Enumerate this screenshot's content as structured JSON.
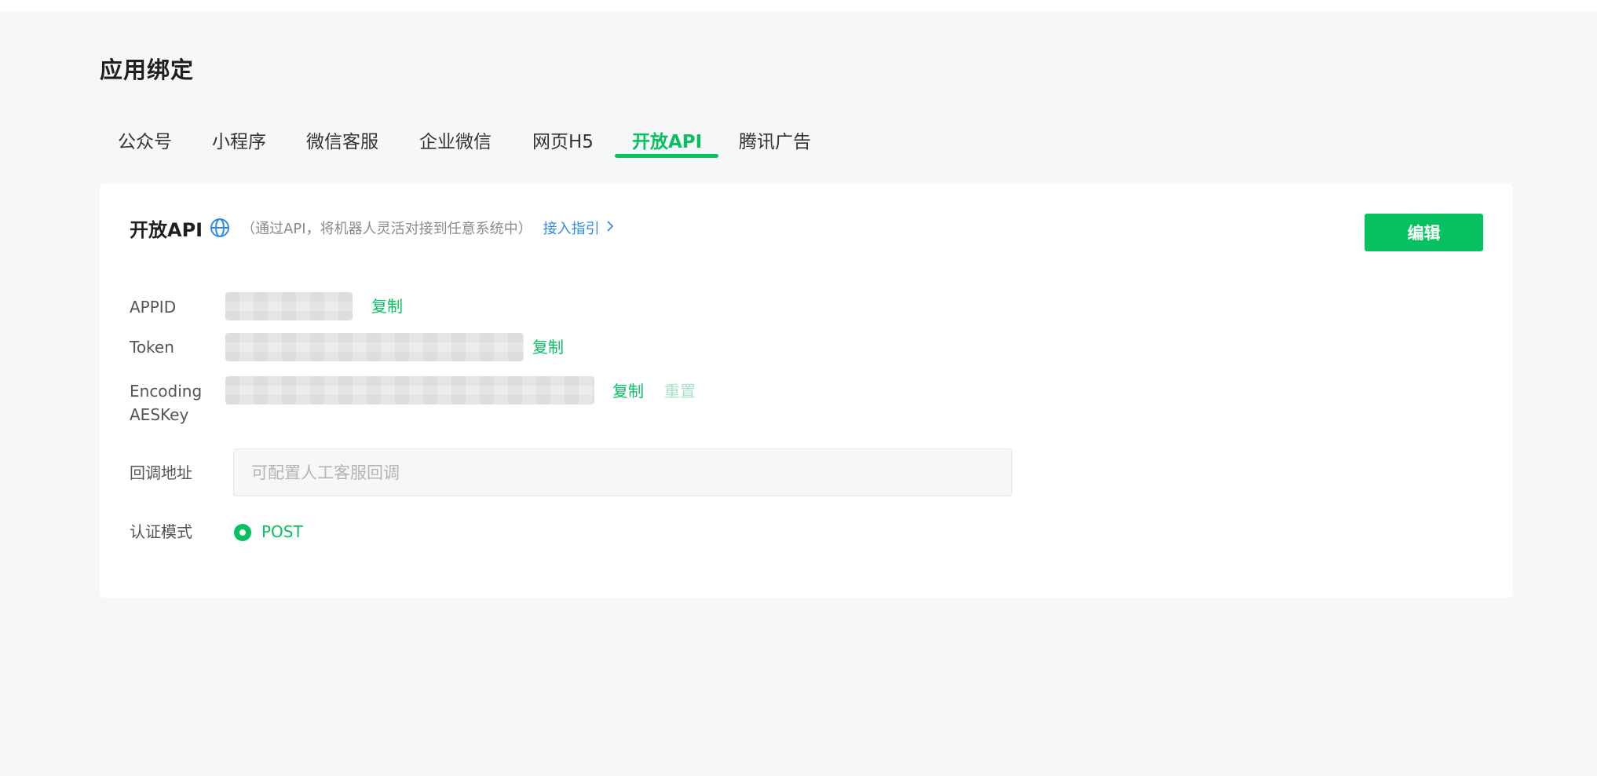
{
  "page": {
    "title": "应用绑定"
  },
  "tabs": [
    {
      "label": "公众号",
      "active": false
    },
    {
      "label": "小程序",
      "active": false
    },
    {
      "label": "微信客服",
      "active": false
    },
    {
      "label": "企业微信",
      "active": false
    },
    {
      "label": "网页H5",
      "active": false
    },
    {
      "label": "开放API",
      "active": true
    },
    {
      "label": "腾讯广告",
      "active": false
    }
  ],
  "card": {
    "title": "开放API",
    "title_icon": "globe-icon",
    "description": "（通过API，将机器人灵活对接到任意系统中）",
    "guide_link": "接入指引",
    "edit_button": "编辑"
  },
  "fields": {
    "appid": {
      "label": "APPID",
      "copy": "复制"
    },
    "token": {
      "label": "Token",
      "copy": "复制"
    },
    "aeskey": {
      "label_line1": "Encoding",
      "label_line2": "AESKey",
      "copy": "复制",
      "reset": "重置"
    },
    "callback": {
      "label": "回调地址",
      "placeholder": "可配置人工客服回调",
      "value": ""
    },
    "auth_mode": {
      "label": "认证模式",
      "option": "POST",
      "selected": true
    }
  },
  "colors": {
    "accent": "#07c160",
    "link": "#2e8ae6",
    "background": "#f6f7f9",
    "card": "#ffffff"
  }
}
